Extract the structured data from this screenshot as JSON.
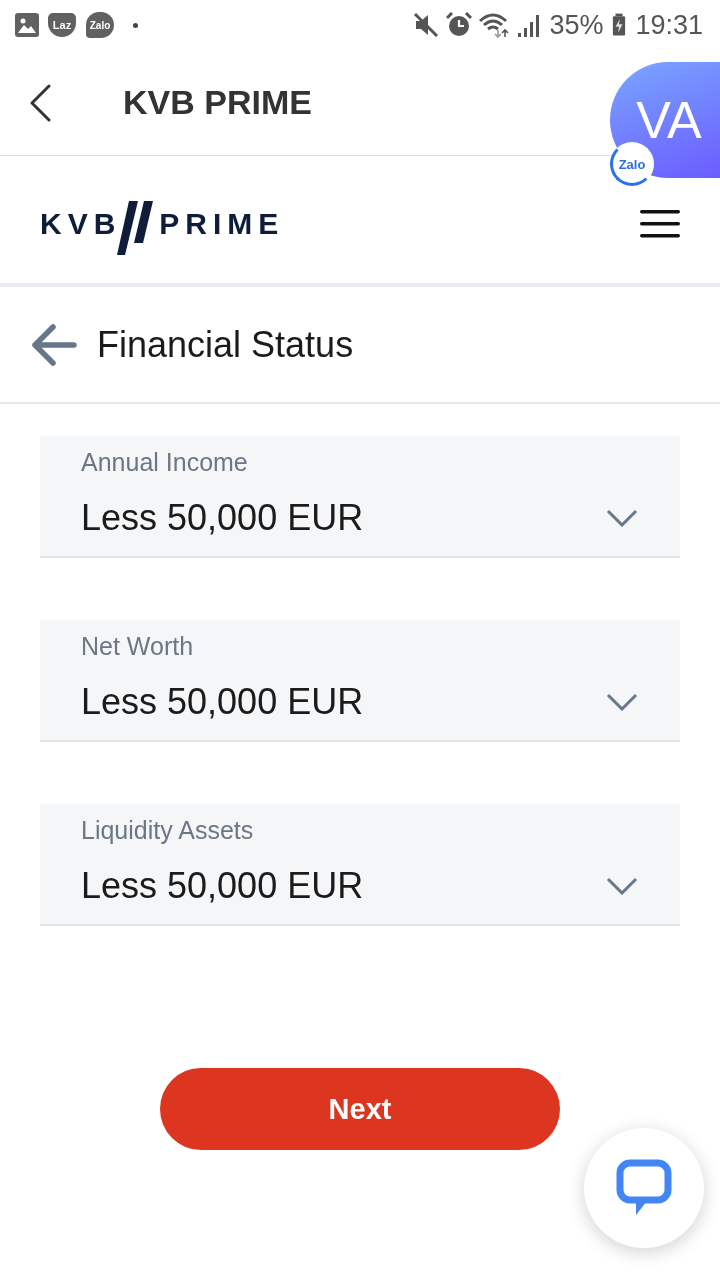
{
  "status_bar": {
    "notifications": [
      {
        "kind": "gallery"
      },
      {
        "kind": "badge",
        "label": "Laz"
      },
      {
        "kind": "bubble",
        "label": "Zalo"
      },
      {
        "kind": "dot"
      }
    ],
    "battery": "35%",
    "time": "19:31"
  },
  "app_bar": {
    "title": "KVB PRIME"
  },
  "chat_head": {
    "initials": "VA",
    "badge": "Zalo"
  },
  "site_header": {
    "logo": {
      "left": "KVB",
      "right": "PRIME"
    }
  },
  "section": {
    "title": "Financial Status"
  },
  "fields": [
    {
      "label": "Annual Income",
      "value": "Less 50,000 EUR"
    },
    {
      "label": "Net Worth",
      "value": "Less 50,000 EUR"
    },
    {
      "label": "Liquidity Assets",
      "value": "Less 50,000 EUR"
    }
  ],
  "next_button": {
    "label": "Next"
  }
}
